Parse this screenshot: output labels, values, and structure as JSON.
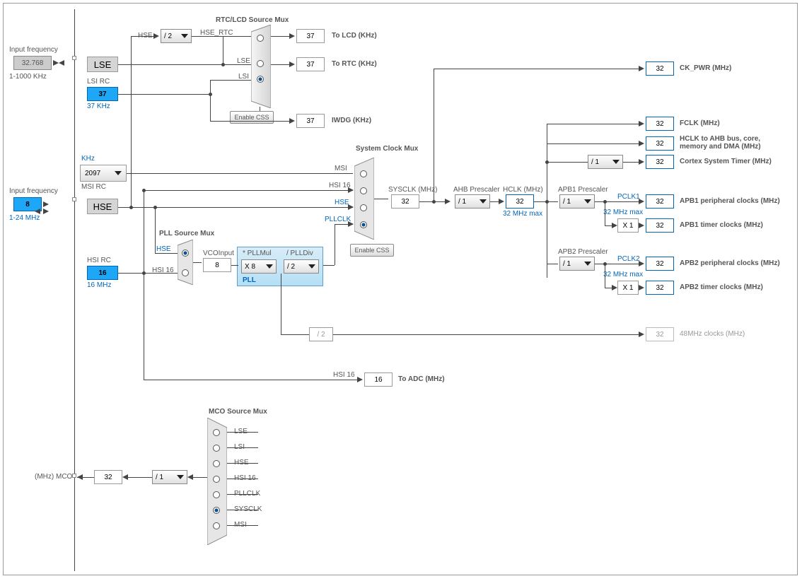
{
  "inputs": {
    "lse_freq_label": "Input frequency",
    "lse_value": "32.768",
    "lse_range": "1-1000 KHz",
    "hse_freq_label": "Input frequency",
    "hse_value": "8",
    "hse_range": "1-24 MHz"
  },
  "sources": {
    "lse": "LSE",
    "lsi_label": "LSI RC",
    "lsi_value": "37",
    "lsi_caption": "37 KHz",
    "msi_unit": "KHz",
    "msi_value": "2097",
    "msi_label": "MSI RC",
    "hse": "HSE",
    "hsi_label": "HSI RC",
    "hsi_value": "16",
    "hsi_caption": "16 MHz"
  },
  "hse_div": {
    "label": "HSE",
    "divider": "/ 2",
    "out_label": "HSE_RTC"
  },
  "rtc_mux": {
    "title": "RTC/LCD Source Mux",
    "inputs": [
      "LSE",
      "LSI"
    ],
    "outputs": [
      {
        "v": "37",
        "l": "To LCD (KHz)"
      },
      {
        "v": "37",
        "l": "To RTC (KHz)"
      }
    ],
    "css_btn": "Enable CSS"
  },
  "iwdg": {
    "v": "37",
    "l": "IWDG (KHz)"
  },
  "sys_mux": {
    "title": "System Clock Mux",
    "inputs": [
      "MSI",
      "HSI 16",
      "HSE",
      "PLLCLK"
    ],
    "css_btn": "Enable CSS",
    "sysclk_label": "SYSCLK (MHz)",
    "sysclk": "32"
  },
  "pll_mux": {
    "title": "PLL Source Mux",
    "inputs": [
      "HSE",
      "HSI 16"
    ],
    "vco_label": "VCOInput",
    "vco": "8"
  },
  "pll": {
    "title": "PLL",
    "mul_label": "* PLLMul",
    "mul": "X 8",
    "div_label": "/ PLLDiv",
    "div": "/ 2"
  },
  "ahb": {
    "label": "AHB Prescaler",
    "val": "/ 1",
    "hclk_label": "HCLK (MHz)",
    "hclk": "32",
    "hclk_max": "32 MHz max"
  },
  "outputs": {
    "ck_pwr": {
      "v": "32",
      "l": "CK_PWR (MHz)"
    },
    "fclk": {
      "v": "32",
      "l": "FCLK (MHz)"
    },
    "hclk_bus": {
      "v": "32",
      "l": "HCLK to AHB bus, core, memory and DMA (MHz)"
    },
    "cortex": {
      "v": "32",
      "l": "Cortex System Timer (MHz)",
      "div": "/ 1"
    },
    "apb1": {
      "label": "APB1 Prescaler",
      "div": "/ 1",
      "pclk": "PCLK1",
      "max": "32 MHz max",
      "periph_v": "32",
      "periph_l": "APB1 peripheral clocks (MHz)",
      "tim_mul": "X 1",
      "tim_v": "32",
      "tim_l": "APB1 timer clocks (MHz)"
    },
    "apb2": {
      "label": "APB2 Prescaler",
      "div": "/ 1",
      "pclk": "PCLK2",
      "max": "32 MHz max",
      "periph_v": "32",
      "periph_l": "APB2 peripheral clocks (MHz)",
      "tim_mul": "X 1",
      "tim_v": "32",
      "tim_l": "APB2 timer clocks (MHz)"
    },
    "usb": {
      "div": "/ 2",
      "v": "32",
      "l": "48MHz clocks (MHz)"
    },
    "adc": {
      "label": "HSI 16",
      "v": "16",
      "l": "To ADC (MHz)"
    }
  },
  "mco": {
    "title": "MCO Source Mux",
    "inputs": [
      "LSE",
      "LSI",
      "HSE",
      "HSI 16",
      "PLLCLK",
      "SYSCLK",
      "MSI"
    ],
    "div": "/ 1",
    "v": "32",
    "l": "(MHz) MCO"
  }
}
